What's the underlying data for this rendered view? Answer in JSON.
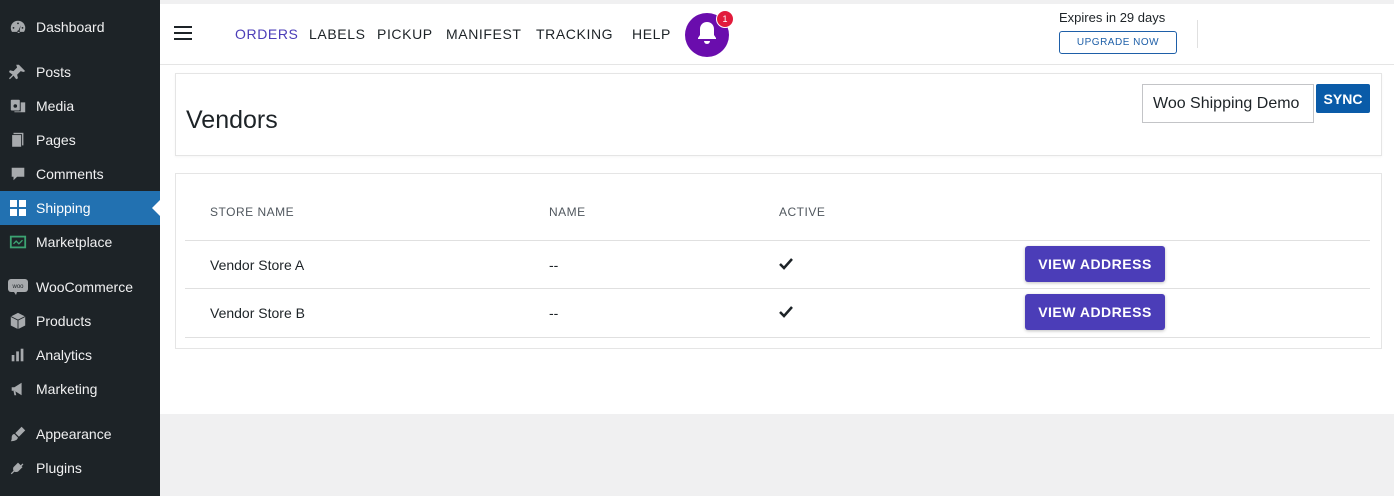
{
  "sidebar": {
    "items": [
      {
        "label": "Dashboard",
        "icon": "dashboard-icon"
      },
      {
        "label": "Posts",
        "icon": "pin-icon"
      },
      {
        "label": "Media",
        "icon": "media-icon"
      },
      {
        "label": "Pages",
        "icon": "pages-icon"
      },
      {
        "label": "Comments",
        "icon": "comment-icon"
      },
      {
        "label": "Shipping",
        "icon": "grid-icon",
        "active": true
      },
      {
        "label": "Marketplace",
        "icon": "marketplace-icon"
      },
      {
        "label": "WooCommerce",
        "icon": "woo-icon"
      },
      {
        "label": "Products",
        "icon": "box-icon"
      },
      {
        "label": "Analytics",
        "icon": "bar-chart-icon"
      },
      {
        "label": "Marketing",
        "icon": "megaphone-icon"
      },
      {
        "label": "Appearance",
        "icon": "brush-icon"
      },
      {
        "label": "Plugins",
        "icon": "plug-icon"
      }
    ]
  },
  "topnav": {
    "links": [
      "ORDERS",
      "LABELS",
      "PICKUP",
      "MANIFEST",
      "TRACKING",
      "HELP"
    ],
    "active": "ORDERS",
    "notification_count": "1",
    "expires_text": "Expires in 29 days",
    "upgrade_label": "UPGRADE NOW"
  },
  "vendors_header": {
    "title": "Vendors",
    "store_select": "Woo Shipping Demo",
    "sync_label": "SYNC"
  },
  "vendors_table": {
    "columns": [
      "STORE NAME",
      "NAME",
      "ACTIVE"
    ],
    "rows": [
      {
        "store_name": "Vendor Store A",
        "name": "--",
        "active": true,
        "action": "VIEW ADDRESS"
      },
      {
        "store_name": "Vendor Store B",
        "name": "--",
        "active": true,
        "action": "VIEW ADDRESS"
      }
    ]
  },
  "colors": {
    "sidebar_bg": "#1d2327",
    "sidebar_active": "#2271b1",
    "accent_purple": "#4b3db8",
    "bell_purple": "#6a0dad",
    "sync_blue": "#0a5ba8",
    "badge_red": "#e21b3c"
  }
}
